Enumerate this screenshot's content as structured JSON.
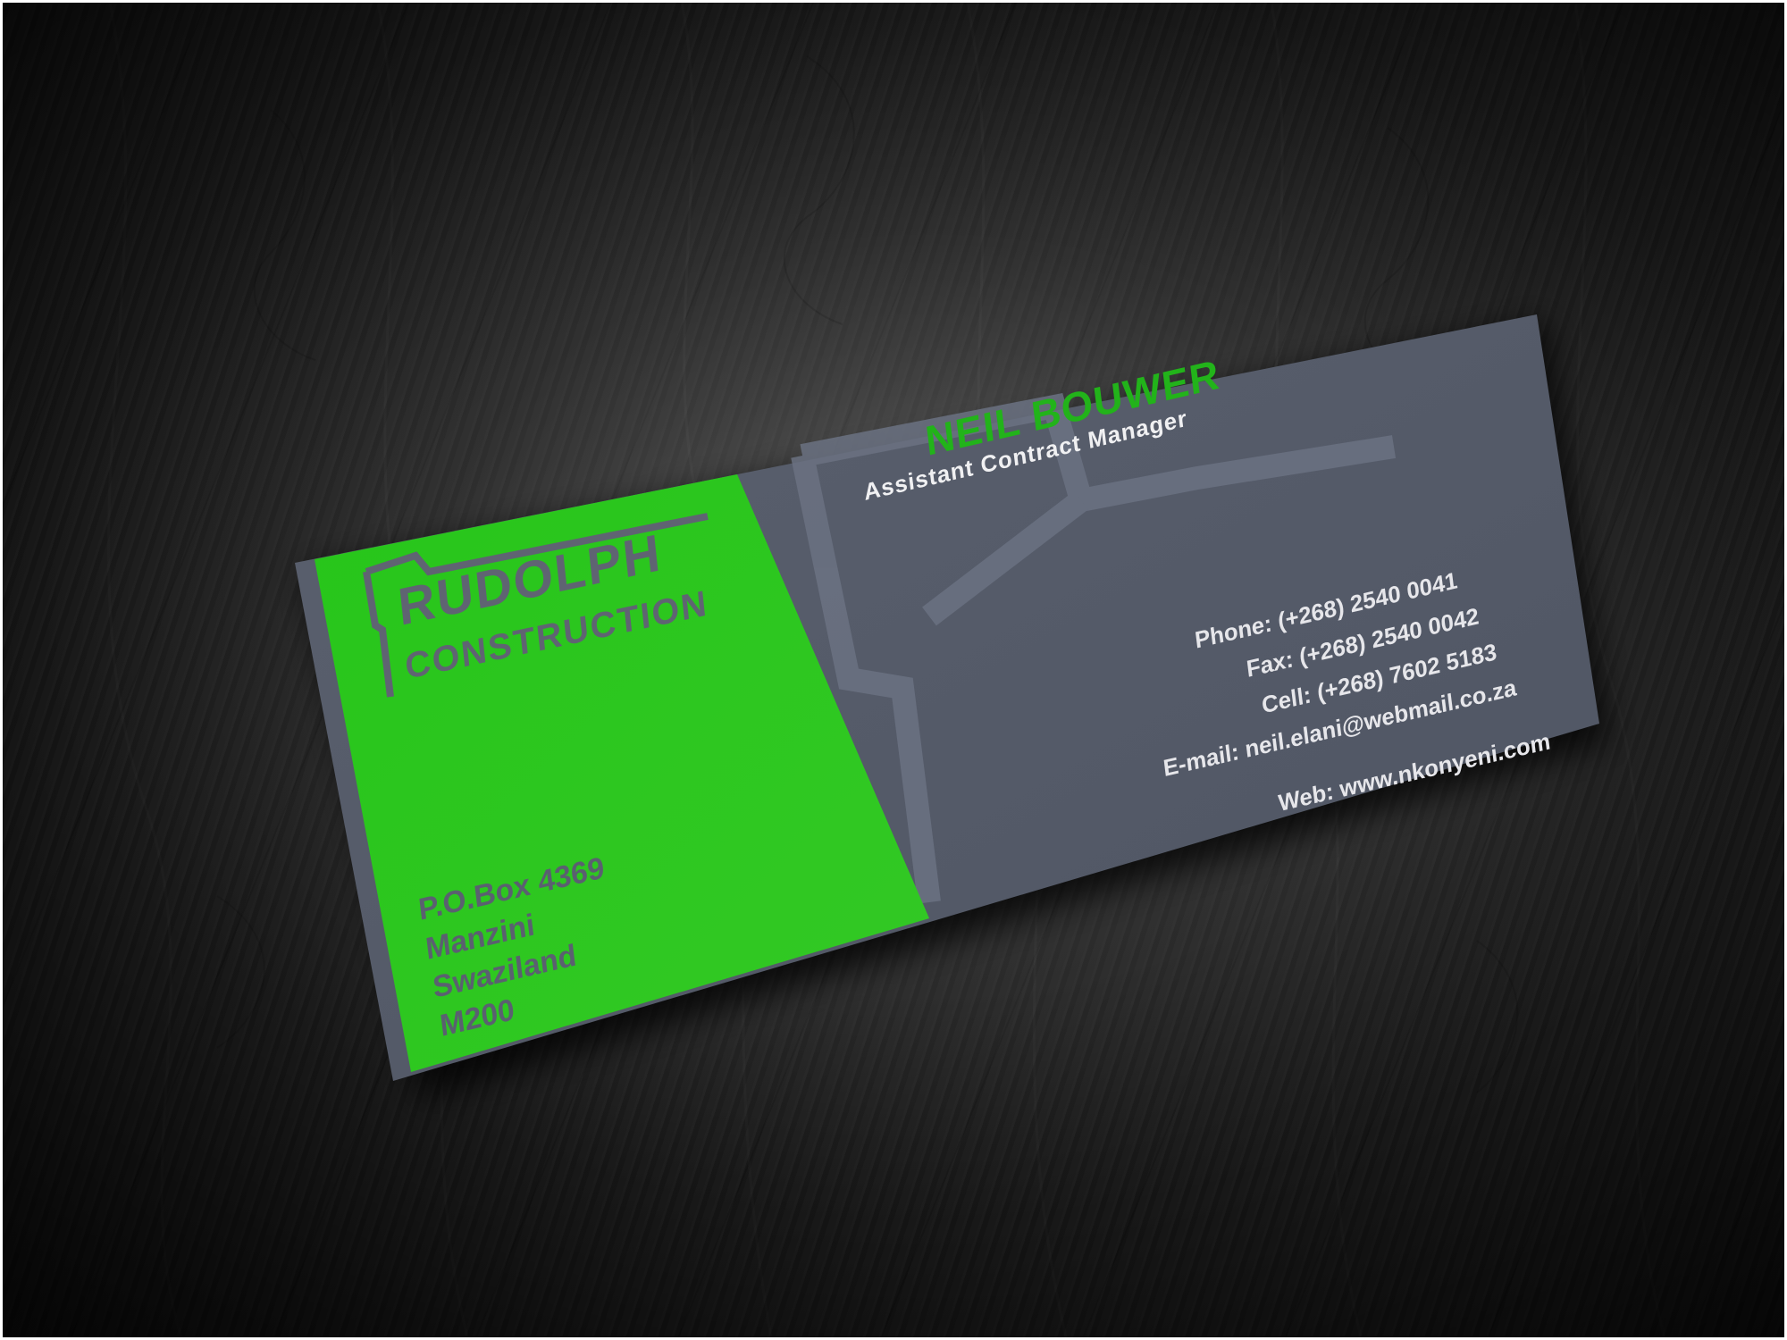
{
  "scene": {
    "description_colors": {
      "table": "#222222",
      "card_green": "#29c41c",
      "card_gray": "#5d6373",
      "logo_gray": "#5f6472",
      "name_green": "#22b31a",
      "text_light": "#e8e8ea",
      "text_gray_on_green": "#5a6070"
    }
  },
  "card": {
    "company": {
      "line1": "RUDOLPH",
      "line2": "CONSTRUCTION",
      "logo_icon": "house-outline-icon"
    },
    "address": {
      "line1": "P.O.Box 4369",
      "line2": "Manzini",
      "line3": "Swaziland",
      "line4": "M200"
    },
    "person": {
      "name": "NEIL BOUWER",
      "title": "Assistant Contract Manager"
    },
    "contact": {
      "phone": "Phone: (+268) 2540 0041",
      "fax": "Fax: (+268) 2540 0042",
      "cell": "Cell: (+268) 7602 5183",
      "email": "E-mail: neil.elani@webmail.co.za",
      "web": "Web: www.nkonyeni.com"
    }
  }
}
